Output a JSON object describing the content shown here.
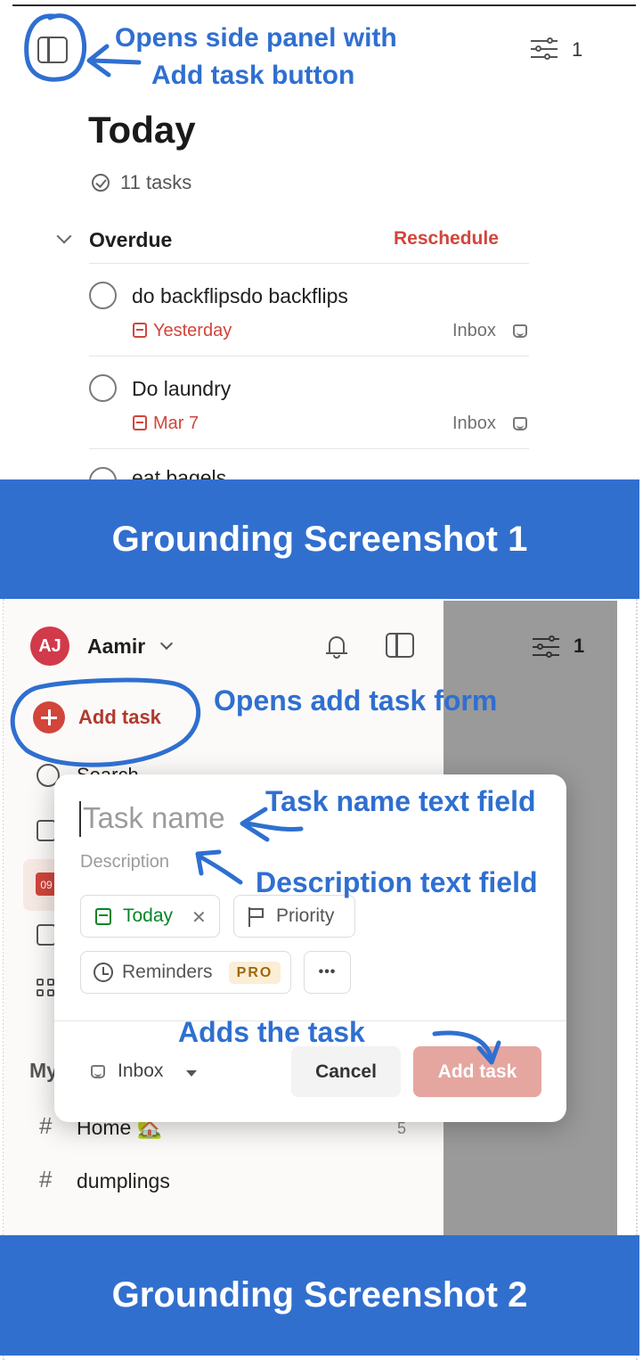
{
  "screenshot1": {
    "filter_count": "1",
    "page_title": "Today",
    "task_count": "11 tasks",
    "section": {
      "title": "Overdue",
      "action": "Reschedule"
    },
    "tasks": [
      {
        "title": "do backflipsdo backflips",
        "due": "Yesterday",
        "project": "Inbox"
      },
      {
        "title": "Do laundry",
        "due": "Mar 7",
        "project": "Inbox"
      },
      {
        "title": "eat bagels"
      }
    ]
  },
  "screenshot2": {
    "user": {
      "initials": "AJ",
      "name": "Aamir"
    },
    "filter_count": "1",
    "sidebar": {
      "add_task": "Add task",
      "search": "Search",
      "today_date": "09",
      "my_projects": "My",
      "projects": [
        {
          "name": "Home 🏡",
          "count": "5"
        },
        {
          "name": "dumplings"
        }
      ]
    },
    "form": {
      "task_name_placeholder": "Task name",
      "description_placeholder": "Description",
      "date_chip": "Today",
      "priority_chip": "Priority",
      "reminders_chip": "Reminders",
      "pro_badge": "PRO",
      "more_label": "•••",
      "project_selector": "Inbox",
      "cancel": "Cancel",
      "submit": "Add task"
    }
  },
  "annotations": {
    "side_panel_line1": "Opens side panel with",
    "side_panel_line2": "Add task button",
    "add_task_form": "Opens add task form",
    "task_name_field": "Task name text field",
    "description_field": "Description text field",
    "adds_task": "Adds the task"
  },
  "banners": {
    "first": "Grounding Screenshot 1",
    "second": "Grounding Screenshot 2"
  },
  "colors": {
    "accent": "#d1453b",
    "annotation": "#2f6fd0",
    "banner": "#316fce",
    "date_green": "#058527"
  }
}
